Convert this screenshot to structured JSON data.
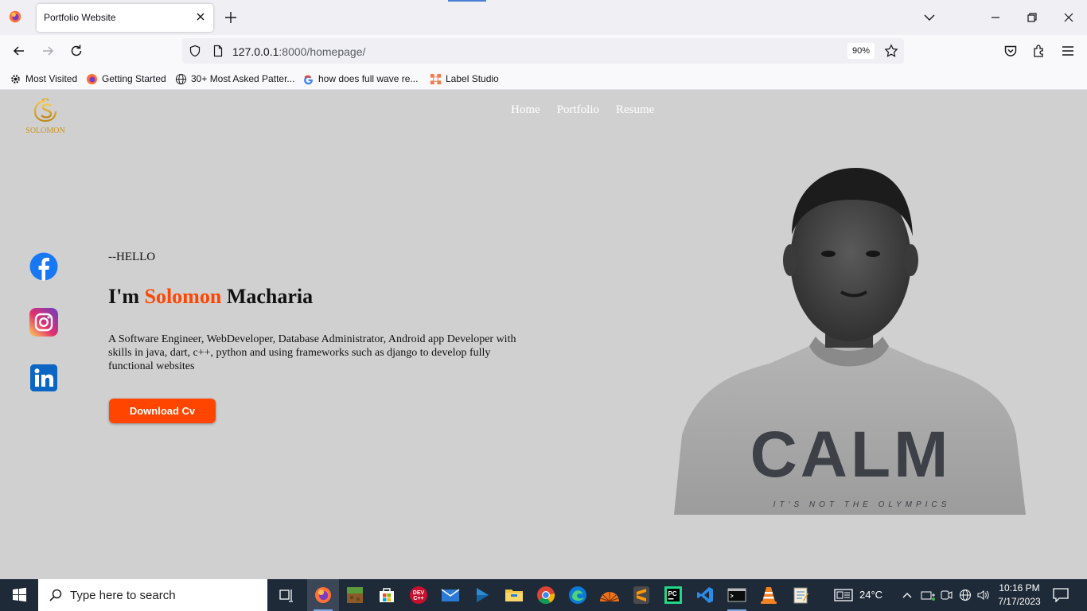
{
  "browser": {
    "tab_title": "Portfolio Website",
    "url_host": "127.0.0.1",
    "url_rest": ":8000/homepage/",
    "zoom": "90%",
    "bookmarks": [
      "Most Visited",
      "Getting Started",
      "30+ Most Asked Patter...",
      "how does full wave re...",
      "Label Studio"
    ]
  },
  "site": {
    "logo_text": "SOLOMON",
    "nav": [
      "Home",
      "Portfolio",
      "Resume"
    ],
    "hello": "--HELLO",
    "headline_prefix": "I'm ",
    "headline_first": "Solomon",
    "headline_last": " Macharia",
    "bio": "A Software Engineer, WebDeveloper, Database Administrator, Android app Developer with skills in java, dart, c++, python and using frameworks such as django to develop fully functional websites",
    "cta": "Download Cv",
    "shirt_text": "CALM",
    "shirt_subtext": "IT'S NOT THE OLYMPICS",
    "accent_color": "#ff4500",
    "background_color": "#d0d0d0",
    "social": [
      "facebook",
      "instagram",
      "linkedin"
    ]
  },
  "taskbar": {
    "search_placeholder": "Type here to search",
    "weather": "24°C",
    "time": "10:16 PM",
    "date": "7/17/2023",
    "apps": [
      "task-view",
      "firefox",
      "minecraft",
      "microsoft-store",
      "dev-cpp",
      "mail",
      "media-player",
      "file-explorer",
      "chrome",
      "edge",
      "app-orange",
      "sublime-text",
      "pycharm",
      "vscode",
      "terminal",
      "vlc",
      "notepad"
    ]
  }
}
